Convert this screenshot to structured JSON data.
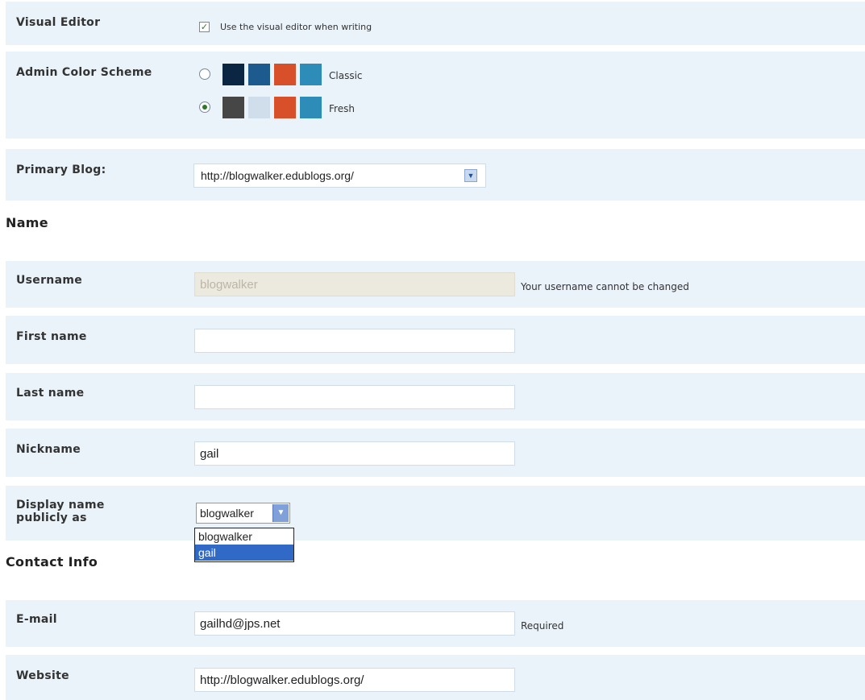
{
  "visual_editor": {
    "label": "Visual Editor",
    "checkbox_label": "Use the visual editor when writing",
    "checked": true,
    "check_mark": "✓"
  },
  "color_scheme": {
    "label": "Admin Color Scheme",
    "schemes": [
      {
        "name": "Classic",
        "selected": false,
        "colors": [
          "#0b2642",
          "#1d5a8e",
          "#d8502a",
          "#2e8cb8"
        ]
      },
      {
        "name": "Fresh",
        "selected": true,
        "colors": [
          "#464646",
          "#cfdeea",
          "#d8502a",
          "#2e8cb8"
        ]
      }
    ]
  },
  "primary_blog": {
    "label": "Primary Blog:",
    "value": "http://blogwalker.edublogs.org/",
    "arrow": "▼"
  },
  "name_section": {
    "title": "Name",
    "username_label": "Username",
    "username_value": "blogwalker",
    "username_note": "Your username cannot be changed",
    "first_name_label": "First name",
    "first_name_value": "",
    "last_name_label": "Last name",
    "last_name_value": "",
    "nickname_label": "Nickname",
    "nickname_value": "gail",
    "display_name_label": "Display name publicly as",
    "display_name_value": "blogwalker",
    "display_name_arrow": "▼",
    "display_name_options": [
      "blogwalker",
      "gail"
    ],
    "display_name_highlighted": "gail"
  },
  "contact_section": {
    "title": "Contact Info",
    "email_label": "E-mail",
    "email_value": "gailhd@jps.net",
    "email_note": "Required",
    "website_label": "Website",
    "website_value": "http://blogwalker.edublogs.org/"
  },
  "colors": {
    "row_background": "#eaf2fa",
    "selected_option": "#3169c6",
    "disabled_field": "#ece9df"
  }
}
